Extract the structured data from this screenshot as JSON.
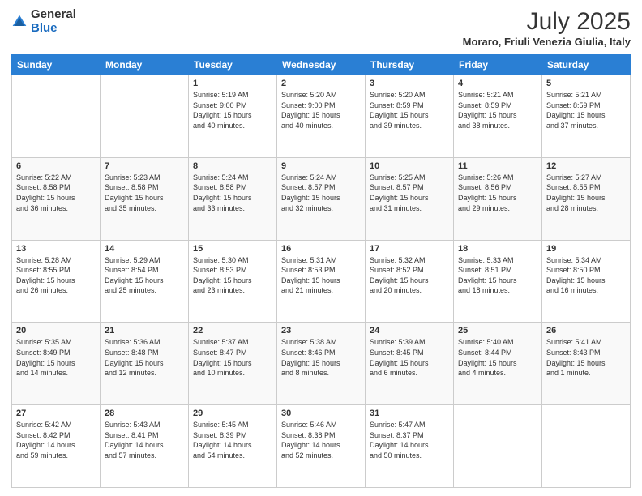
{
  "header": {
    "logo_general": "General",
    "logo_blue": "Blue",
    "month": "July 2025",
    "location": "Moraro, Friuli Venezia Giulia, Italy"
  },
  "days_of_week": [
    "Sunday",
    "Monday",
    "Tuesday",
    "Wednesday",
    "Thursday",
    "Friday",
    "Saturday"
  ],
  "weeks": [
    {
      "days": [
        {
          "num": "",
          "detail": ""
        },
        {
          "num": "",
          "detail": ""
        },
        {
          "num": "1",
          "detail": "Sunrise: 5:19 AM\nSunset: 9:00 PM\nDaylight: 15 hours\nand 40 minutes."
        },
        {
          "num": "2",
          "detail": "Sunrise: 5:20 AM\nSunset: 9:00 PM\nDaylight: 15 hours\nand 40 minutes."
        },
        {
          "num": "3",
          "detail": "Sunrise: 5:20 AM\nSunset: 8:59 PM\nDaylight: 15 hours\nand 39 minutes."
        },
        {
          "num": "4",
          "detail": "Sunrise: 5:21 AM\nSunset: 8:59 PM\nDaylight: 15 hours\nand 38 minutes."
        },
        {
          "num": "5",
          "detail": "Sunrise: 5:21 AM\nSunset: 8:59 PM\nDaylight: 15 hours\nand 37 minutes."
        }
      ]
    },
    {
      "days": [
        {
          "num": "6",
          "detail": "Sunrise: 5:22 AM\nSunset: 8:58 PM\nDaylight: 15 hours\nand 36 minutes."
        },
        {
          "num": "7",
          "detail": "Sunrise: 5:23 AM\nSunset: 8:58 PM\nDaylight: 15 hours\nand 35 minutes."
        },
        {
          "num": "8",
          "detail": "Sunrise: 5:24 AM\nSunset: 8:58 PM\nDaylight: 15 hours\nand 33 minutes."
        },
        {
          "num": "9",
          "detail": "Sunrise: 5:24 AM\nSunset: 8:57 PM\nDaylight: 15 hours\nand 32 minutes."
        },
        {
          "num": "10",
          "detail": "Sunrise: 5:25 AM\nSunset: 8:57 PM\nDaylight: 15 hours\nand 31 minutes."
        },
        {
          "num": "11",
          "detail": "Sunrise: 5:26 AM\nSunset: 8:56 PM\nDaylight: 15 hours\nand 29 minutes."
        },
        {
          "num": "12",
          "detail": "Sunrise: 5:27 AM\nSunset: 8:55 PM\nDaylight: 15 hours\nand 28 minutes."
        }
      ]
    },
    {
      "days": [
        {
          "num": "13",
          "detail": "Sunrise: 5:28 AM\nSunset: 8:55 PM\nDaylight: 15 hours\nand 26 minutes."
        },
        {
          "num": "14",
          "detail": "Sunrise: 5:29 AM\nSunset: 8:54 PM\nDaylight: 15 hours\nand 25 minutes."
        },
        {
          "num": "15",
          "detail": "Sunrise: 5:30 AM\nSunset: 8:53 PM\nDaylight: 15 hours\nand 23 minutes."
        },
        {
          "num": "16",
          "detail": "Sunrise: 5:31 AM\nSunset: 8:53 PM\nDaylight: 15 hours\nand 21 minutes."
        },
        {
          "num": "17",
          "detail": "Sunrise: 5:32 AM\nSunset: 8:52 PM\nDaylight: 15 hours\nand 20 minutes."
        },
        {
          "num": "18",
          "detail": "Sunrise: 5:33 AM\nSunset: 8:51 PM\nDaylight: 15 hours\nand 18 minutes."
        },
        {
          "num": "19",
          "detail": "Sunrise: 5:34 AM\nSunset: 8:50 PM\nDaylight: 15 hours\nand 16 minutes."
        }
      ]
    },
    {
      "days": [
        {
          "num": "20",
          "detail": "Sunrise: 5:35 AM\nSunset: 8:49 PM\nDaylight: 15 hours\nand 14 minutes."
        },
        {
          "num": "21",
          "detail": "Sunrise: 5:36 AM\nSunset: 8:48 PM\nDaylight: 15 hours\nand 12 minutes."
        },
        {
          "num": "22",
          "detail": "Sunrise: 5:37 AM\nSunset: 8:47 PM\nDaylight: 15 hours\nand 10 minutes."
        },
        {
          "num": "23",
          "detail": "Sunrise: 5:38 AM\nSunset: 8:46 PM\nDaylight: 15 hours\nand 8 minutes."
        },
        {
          "num": "24",
          "detail": "Sunrise: 5:39 AM\nSunset: 8:45 PM\nDaylight: 15 hours\nand 6 minutes."
        },
        {
          "num": "25",
          "detail": "Sunrise: 5:40 AM\nSunset: 8:44 PM\nDaylight: 15 hours\nand 4 minutes."
        },
        {
          "num": "26",
          "detail": "Sunrise: 5:41 AM\nSunset: 8:43 PM\nDaylight: 15 hours\nand 1 minute."
        }
      ]
    },
    {
      "days": [
        {
          "num": "27",
          "detail": "Sunrise: 5:42 AM\nSunset: 8:42 PM\nDaylight: 14 hours\nand 59 minutes."
        },
        {
          "num": "28",
          "detail": "Sunrise: 5:43 AM\nSunset: 8:41 PM\nDaylight: 14 hours\nand 57 minutes."
        },
        {
          "num": "29",
          "detail": "Sunrise: 5:45 AM\nSunset: 8:39 PM\nDaylight: 14 hours\nand 54 minutes."
        },
        {
          "num": "30",
          "detail": "Sunrise: 5:46 AM\nSunset: 8:38 PM\nDaylight: 14 hours\nand 52 minutes."
        },
        {
          "num": "31",
          "detail": "Sunrise: 5:47 AM\nSunset: 8:37 PM\nDaylight: 14 hours\nand 50 minutes."
        },
        {
          "num": "",
          "detail": ""
        },
        {
          "num": "",
          "detail": ""
        }
      ]
    }
  ]
}
